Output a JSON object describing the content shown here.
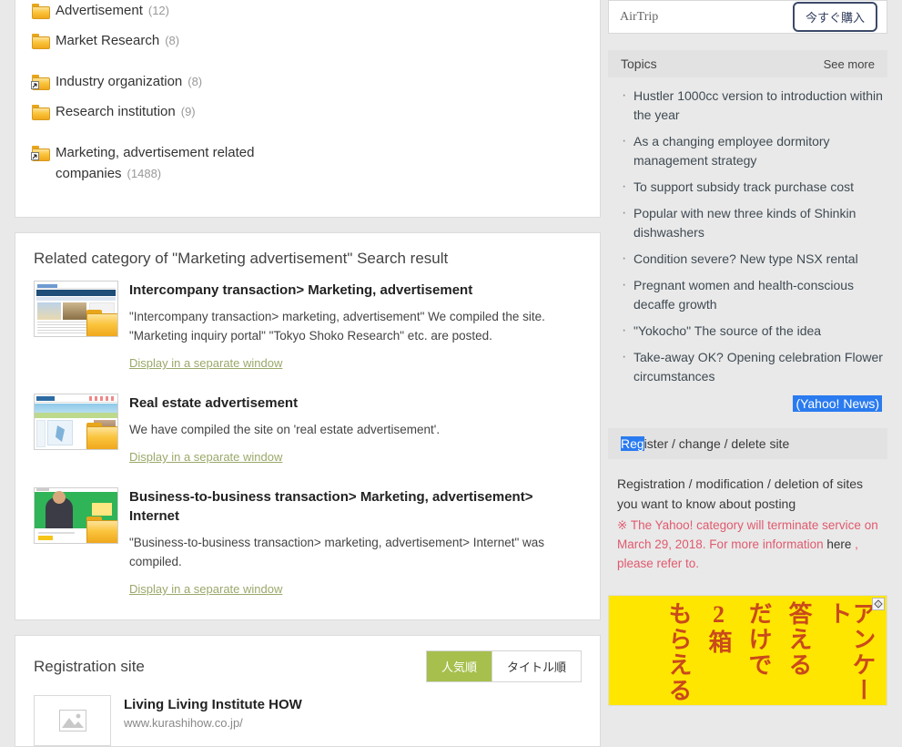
{
  "categories": [
    {
      "label": "Advertisement",
      "count": "(12)",
      "icon": "folder-icon",
      "gap": false
    },
    {
      "label": "Market Research",
      "count": "(8)",
      "icon": "folder-icon",
      "gap": false
    },
    {
      "label": "Industry organization",
      "count": "(8)",
      "icon": "folder-shortcut-icon",
      "gap": true
    },
    {
      "label": "Research institution",
      "count": "(9)",
      "icon": "folder-icon",
      "gap": false
    },
    {
      "label": "Marketing, advertisement related companies",
      "count": "(1488)",
      "icon": "folder-shortcut-icon",
      "gap": true
    }
  ],
  "search_results": {
    "title": "Related category of \"Marketing advertisement\" Search result",
    "items": [
      {
        "title": "Intercompany transaction> Marketing, advertisement",
        "desc": "\"Intercompany transaction> marketing, advertisement\" We compiled the site. \"Marketing inquiry portal\" \"Tokyo Shoko Research\" etc. are posted.",
        "link": "Display in a separate window"
      },
      {
        "title": "Real estate advertisement",
        "desc": "We have compiled the site on 'real estate advertisement'.",
        "link": "Display in a separate window"
      },
      {
        "title": "Business-to-business transaction> Marketing, advertisement> Internet",
        "desc": "\"Business-to-business transaction> marketing, advertisement> Internet\" was compiled.",
        "link": "Display in a separate window"
      }
    ]
  },
  "registration_site": {
    "title": "Registration site",
    "sort_popular": "人気順",
    "sort_title": "タイトル順",
    "items": [
      {
        "name": "Living Living Institute HOW",
        "url": "www.kurashihow.co.jp/"
      }
    ]
  },
  "sidebar": {
    "ad": {
      "brand": "AirTrip",
      "cta": "今すぐ購入"
    },
    "topics": {
      "heading": "Topics",
      "see_more": "See more",
      "items": [
        "Hustler 1000cc version to introduction within the year",
        "As a changing employee dormitory management strategy",
        "To support subsidy track purchase cost",
        "Popular with new three kinds of Shinkin dishwashers",
        "Condition severe? New type NSX rental",
        "Pregnant women and health-conscious decaffe growth",
        "\"Yokocho\" The source of the idea",
        "Take-away OK? Opening celebration Flower circumstances"
      ],
      "source": "(Yahoo! News)"
    },
    "register_bar": {
      "selected": "Reg",
      "rest": "ister / change / delete site"
    },
    "register_note": "Registration / modification / deletion of sites you want to know about posting",
    "warning": {
      "mark": "※",
      "text_before": " The Yahoo! category will terminate service on March 29, 2018. For more information ",
      "link": "here",
      "text_after": " , please refer to."
    },
    "survey_ad": {
      "columns": [
        "アンケート",
        "答える",
        "だけで",
        "2箱",
        "もらえる"
      ],
      "adchoice_icon": "info-triangle-icon"
    }
  },
  "colors": {
    "page_bg": "#e9e9e9",
    "panel_bg": "#ffffff",
    "accent_green": "#a6bf4d",
    "link_olive": "#9aa86a",
    "selection_blue": "#2a7bf0",
    "warning_red": "#e05a6e",
    "ad_yellow": "#ffe600"
  }
}
